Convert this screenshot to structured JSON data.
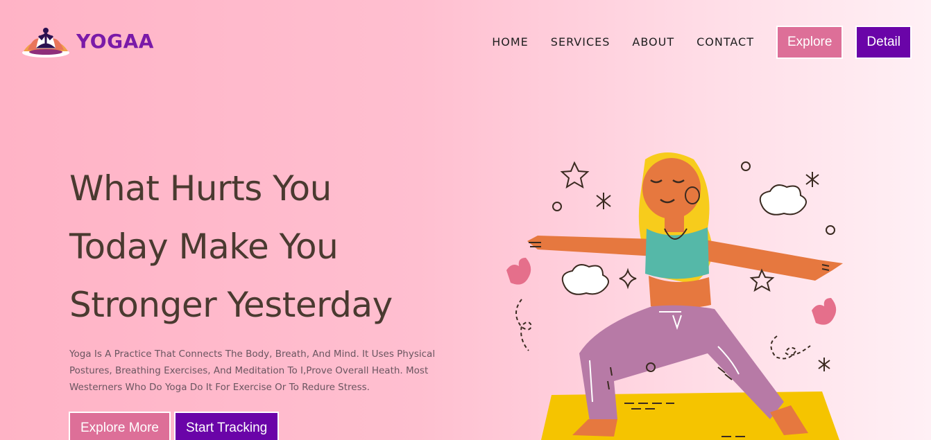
{
  "brand": {
    "name": "YOGAA",
    "logo_icon": "meditation-lotus-icon"
  },
  "nav": {
    "items": [
      "HOME",
      "SERVICES",
      "ABOUT",
      "CONTACT"
    ],
    "explore_label": "Explore",
    "detail_label": "Detail"
  },
  "hero": {
    "title_lines": [
      "What Hurts You",
      "Today Make You",
      "Stronger Yesterday"
    ],
    "description_lines": [
      "Yoga Is A Practice That Connects The Body, Breath, And Mind. It Uses Physical",
      "Postures, Breathing Exercises, And Meditation To I,Prove Overall Heath. Most",
      "Westerners Who Do Yoga Do It For Exercise Or To Redure Stress."
    ],
    "explore_more_label": "Explore More",
    "start_tracking_label": "Start Tracking"
  },
  "colors": {
    "accent_pink": "#dd6f98",
    "accent_purple": "#6a04a8",
    "brand_purple": "#7a1aa8",
    "title_brown": "#4a3a30"
  },
  "illustration": {
    "icon": "yoga-warrior-pose-illustration"
  }
}
